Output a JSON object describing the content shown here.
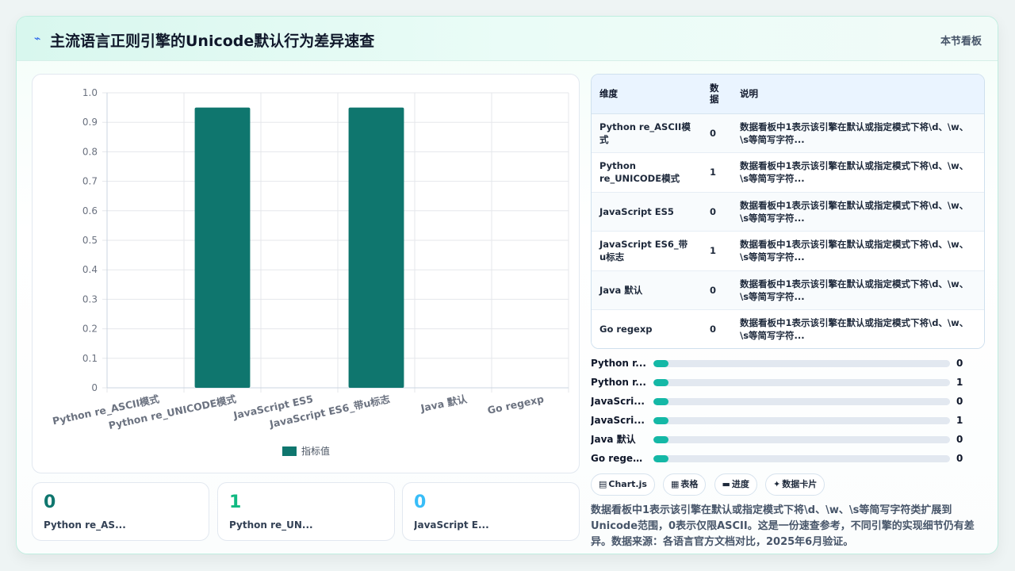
{
  "header": {
    "icon": "sparkle-icon",
    "title": "主流语言正则引擎的Unicode默认行为差异速查",
    "tag": "本节看板"
  },
  "colors": {
    "bar": "#0f766e",
    "progress": "#14b8a6",
    "kpi_1": "#0f766e",
    "kpi_2": "#10b981",
    "kpi_3": "#38bdf8"
  },
  "chart_data": {
    "type": "bar",
    "categories": [
      "Python re_ASCII模式",
      "Python re_UNICODE模式",
      "JavaScript ES5",
      "JavaScript ES6_带u标志",
      "Java 默认",
      "Go regexp"
    ],
    "series": [
      {
        "name": "指标值",
        "values": [
          0,
          0.95,
          0,
          0.95,
          0,
          0
        ]
      }
    ],
    "yticks": [
      "0",
      "0.1",
      "0.2",
      "0.3",
      "0.4",
      "0.5",
      "0.6",
      "0.7",
      "0.8",
      "0.9",
      "1.0"
    ],
    "ylim": [
      0,
      1
    ],
    "grid": true,
    "legend": "bottom"
  },
  "kpis": [
    {
      "value": "0",
      "label": "Python re_AS..."
    },
    {
      "value": "1",
      "label": "Python re_UN..."
    },
    {
      "value": "0",
      "label": "JavaScript E..."
    }
  ],
  "table": {
    "headers": [
      "维度",
      "数据",
      "说明"
    ],
    "rows": [
      {
        "dim": "Python re_ASCII模式",
        "val": "0",
        "desc": "数据看板中1表示该引擎在默认或指定模式下将\\d、\\w、\\s等简写字符..."
      },
      {
        "dim": "Python re_UNICODE模式",
        "val": "1",
        "desc": "数据看板中1表示该引擎在默认或指定模式下将\\d、\\w、\\s等简写字符..."
      },
      {
        "dim": "JavaScript ES5",
        "val": "0",
        "desc": "数据看板中1表示该引擎在默认或指定模式下将\\d、\\w、\\s等简写字符..."
      },
      {
        "dim": "JavaScript ES6_带u标志",
        "val": "1",
        "desc": "数据看板中1表示该引擎在默认或指定模式下将\\d、\\w、\\s等简写字符..."
      },
      {
        "dim": "Java 默认",
        "val": "0",
        "desc": "数据看板中1表示该引擎在默认或指定模式下将\\d、\\w、\\s等简写字符..."
      },
      {
        "dim": "Go regexp",
        "val": "0",
        "desc": "数据看板中1表示该引擎在默认或指定模式下将\\d、\\w、\\s等简写字符..."
      }
    ]
  },
  "progress": [
    {
      "label": "Python r...",
      "value": "0",
      "fraction": 0
    },
    {
      "label": "Python r...",
      "value": "1",
      "fraction": 0
    },
    {
      "label": "JavaScri...",
      "value": "0",
      "fraction": 0
    },
    {
      "label": "JavaScri...",
      "value": "1",
      "fraction": 0
    },
    {
      "label": "Java 默认",
      "value": "0",
      "fraction": 0
    },
    {
      "label": "Go regex...",
      "value": "0",
      "fraction": 0
    }
  ],
  "chips": [
    {
      "icon": "chart-icon",
      "glyph": "▤",
      "label": "Chart.js"
    },
    {
      "icon": "table-icon",
      "glyph": "▦",
      "label": "表格"
    },
    {
      "icon": "progress-icon",
      "glyph": "▬",
      "label": "进度"
    },
    {
      "icon": "card-icon",
      "glyph": "✦",
      "label": "数据卡片"
    }
  ],
  "note": "数据看板中1表示该引擎在默认或指定模式下将\\d、\\w、\\s等简写字符类扩展到Unicode范围，0表示仅限ASCII。这是一份速查参考，不同引擎的实现细节仍有差异。数据来源：各语言官方文档对比，2025年6月验证。"
}
